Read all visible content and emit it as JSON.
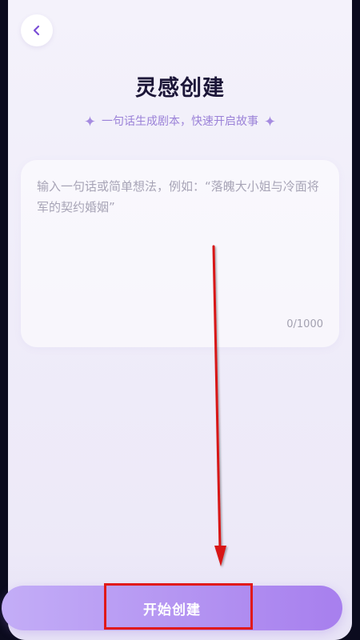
{
  "header": {
    "back_icon": "chevron-left-icon",
    "title": "灵感创建",
    "subtitle": "一句话生成剧本，快速开启故事",
    "sparkle_icon": "sparkle-icon"
  },
  "input": {
    "placeholder": "输入一句话或简单想法，例如：“落魄大小姐与冷面将军的契约婚姻”",
    "value": "",
    "counter": "0/1000"
  },
  "actions": {
    "start_label": "开始创建"
  },
  "colors": {
    "accent": "#9b82d8",
    "button_start": "#c3adf7",
    "button_end": "#a77fee",
    "title": "#1c1638",
    "annotation": "#e11919"
  }
}
